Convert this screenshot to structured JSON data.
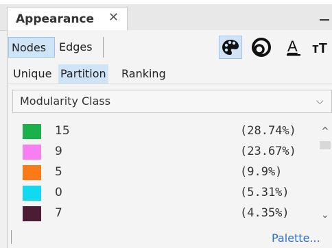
{
  "window": {
    "tab_title": "Appearance",
    "tab_close": "✕"
  },
  "toolbar": {
    "nodes_label": "Nodes",
    "edges_label": "Edges",
    "selected_mode": "Nodes",
    "tools": [
      {
        "icon": "palette-icon",
        "active": true
      },
      {
        "icon": "node-size-icon",
        "active": false
      },
      {
        "icon": "label-color-icon",
        "glyph": "A",
        "active": false
      },
      {
        "icon": "label-size-icon",
        "glyph": "тТ",
        "active": false
      }
    ]
  },
  "subtabs": {
    "items": [
      "Unique",
      "Partition",
      "Ranking"
    ],
    "selected": "Partition"
  },
  "attribute_dropdown": {
    "value": "Modularity Class",
    "chevron": "⌵"
  },
  "partition_list": [
    {
      "label": "15",
      "percent": "(28.74%)",
      "color": "#1bb14a"
    },
    {
      "label": "9",
      "percent": "(23.67%)",
      "color": "#f87ff2"
    },
    {
      "label": "5",
      "percent": "(9.9%)",
      "color": "#fb7a18"
    },
    {
      "label": "0",
      "percent": "(5.31%)",
      "color": "#12d9f2"
    },
    {
      "label": "7",
      "percent": "(4.35%)",
      "color": "#4b1c33"
    }
  ],
  "scrollbar": {
    "up": "^",
    "down": "⌄"
  },
  "footer": {
    "palette_link": "Palette..."
  },
  "colors": {
    "selected_bg": "#cfe4f7",
    "link": "#2f6fc9"
  }
}
